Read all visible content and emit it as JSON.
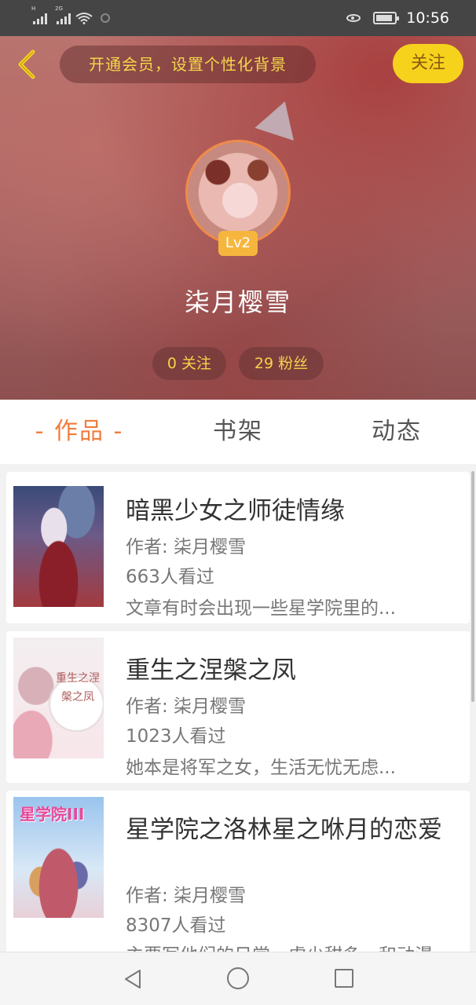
{
  "status_bar": {
    "signal_1_tag": "H",
    "signal_2_tag": "2G",
    "time": "10:56"
  },
  "header": {
    "vip_banner": "开通会员，设置个性化背景",
    "follow_label": "关注",
    "level": "Lv2",
    "user_name": "柒月樱雪",
    "following_stat": "0 关注",
    "fans_stat": "29 粉丝"
  },
  "tabs": [
    {
      "label": "- 作品 -",
      "active": true
    },
    {
      "label": "书架",
      "active": false
    },
    {
      "label": "动态",
      "active": false
    }
  ],
  "books": [
    {
      "title": "暗黑少女之师徒情缘",
      "author": "作者: 柒月樱雪",
      "views": "663人看过",
      "summary": "文章有时会出现一些星学院里的..."
    },
    {
      "title": "重生之涅槃之凤",
      "author": "作者: 柒月樱雪",
      "views": "1023人看过",
      "summary": "她本是将军之女，生活无忧无虑...",
      "cover_text": "重生之涅槃之凤"
    },
    {
      "title": "星学院之洛林星之咻月的恋爱",
      "author": "作者: 柒月樱雪",
      "views": "8307人看过",
      "summary": "主要写他们的日常，虐少甜多，和动漫",
      "cover_text": "星学院III"
    }
  ],
  "colors": {
    "accent": "#f07d3c",
    "follow_button": "#f7d21c",
    "banner_text": "#f6d64c",
    "level_badge": "#f6b63e"
  },
  "icons": {
    "back": "chevron-left-icon",
    "nav_back": "triangle-back-icon",
    "nav_home": "circle-home-icon",
    "nav_recent": "square-recent-icon"
  }
}
